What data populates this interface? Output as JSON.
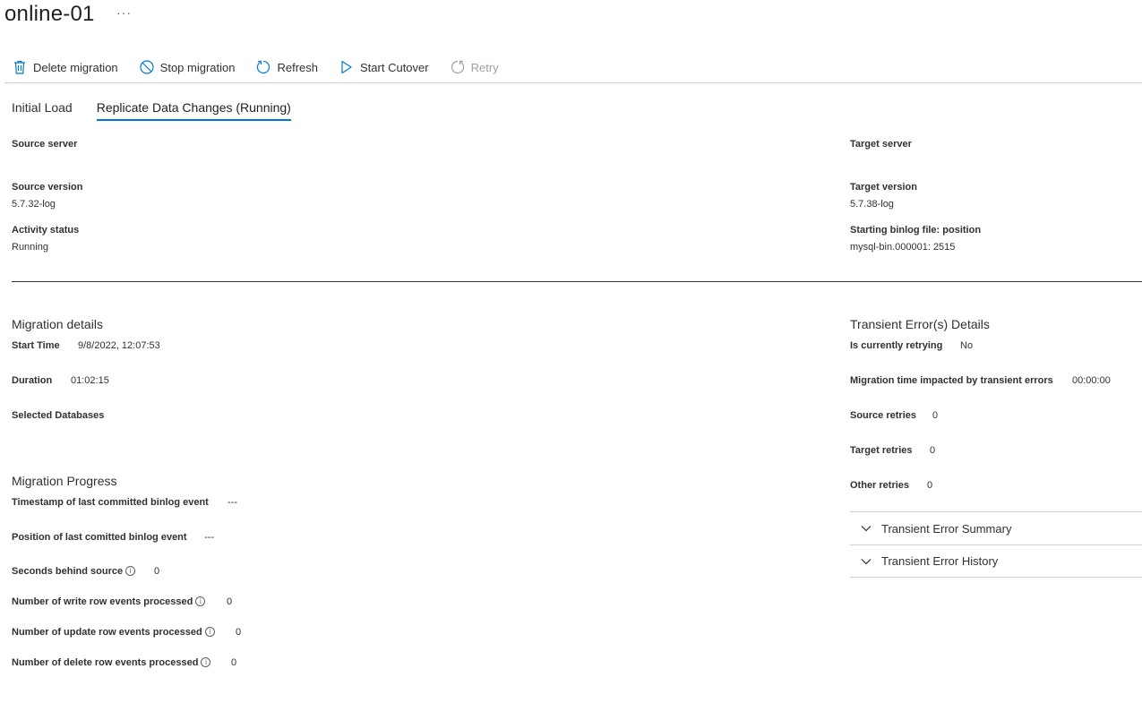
{
  "header": {
    "title": "online-01",
    "more": "···"
  },
  "toolbar": {
    "delete": "Delete migration",
    "stop": "Stop migration",
    "refresh": "Refresh",
    "cutover": "Start Cutover",
    "retry": "Retry"
  },
  "tabs": [
    "Initial Load",
    "Replicate Data Changes (Running)"
  ],
  "server": {
    "source_server_label": "Source server",
    "target_server_label": "Target server",
    "source_version_label": "Source version",
    "source_version": "5.7.32-log",
    "target_version_label": "Target version",
    "target_version": "5.7.38-log",
    "activity_status_label": "Activity status",
    "activity_status": "Running",
    "binlog_label": "Starting binlog file: position",
    "binlog_value": "mysql-bin.000001: 2515"
  },
  "details": {
    "title": "Migration details",
    "start_time_label": "Start Time",
    "start_time": "9/8/2022, 12:07:53",
    "duration_label": "Duration",
    "duration": "01:02:15",
    "selected_db_label": "Selected Databases"
  },
  "progress": {
    "title": "Migration Progress",
    "timestamp_label": "Timestamp of last committed binlog event",
    "timestamp": "---",
    "position_label": "Position of last comitted binlog event",
    "position": "---",
    "seconds_label": "Seconds behind source",
    "seconds": "0",
    "write_label": "Number of write row events processed",
    "write": "0",
    "update_label": "Number of update row events processed",
    "update": "0",
    "delete_label": "Number of delete row events processed",
    "delete": "0"
  },
  "transient": {
    "title": "Transient Error(s) Details",
    "retrying_label": "Is currently retrying",
    "retrying": "No",
    "impacted_label": "Migration time impacted by transient errors",
    "impacted": "00:00:00",
    "source_retries_label": "Source retries",
    "source_retries": "0",
    "target_retries_label": "Target retries",
    "target_retries": "0",
    "other_retries_label": "Other retries",
    "other_retries": "0",
    "summary": "Transient Error Summary",
    "history": "Transient Error History"
  },
  "icons": {
    "delete": "trash-icon",
    "stop": "circle-slash-icon",
    "refresh": "refresh-icon",
    "cutover": "play-icon",
    "retry": "retry-icon",
    "info": "info-icon",
    "expand": "chevron-down-icon"
  },
  "colors": {
    "accent": "#0078d4",
    "text": "#323130",
    "disabled": "#a19f9d"
  }
}
